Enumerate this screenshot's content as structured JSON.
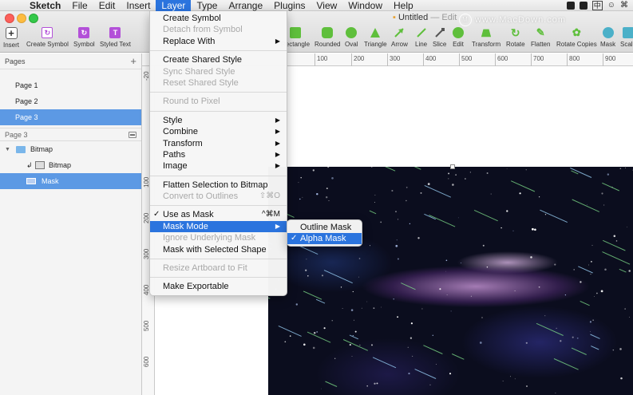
{
  "menubar": {
    "items": [
      "Sketch",
      "File",
      "Edit",
      "Insert",
      "Layer",
      "Type",
      "Arrange",
      "Plugins",
      "View",
      "Window",
      "Help"
    ],
    "active": "Layer",
    "ime_label": "中"
  },
  "window": {
    "doc_title": "Untitled",
    "doc_status": "— Edit"
  },
  "toolbar": {
    "left_items": [
      {
        "label": "Insert",
        "icon": "plus-icon"
      },
      {
        "label": "Create Symbol",
        "icon": "create-symbol-icon"
      },
      {
        "label": "Symbol",
        "icon": "symbol-icon"
      },
      {
        "label": "Styled Text",
        "icon": "styled-text-icon"
      }
    ],
    "right_items": [
      {
        "label": "Rectangle",
        "icon": "rectangle-icon"
      },
      {
        "label": "Rounded",
        "icon": "rounded-rectangle-icon"
      },
      {
        "label": "Oval",
        "icon": "oval-icon"
      },
      {
        "label": "Triangle",
        "icon": "triangle-icon"
      },
      {
        "label": "Arrow",
        "icon": "arrow-icon"
      },
      {
        "label": "Line",
        "icon": "line-icon"
      },
      {
        "label": "Slice",
        "icon": "slice-icon"
      },
      {
        "label": "Edit",
        "icon": "edit-icon"
      },
      {
        "label": "Transform",
        "icon": "transform-icon"
      },
      {
        "label": "Rotate",
        "icon": "rotate-icon"
      },
      {
        "label": "Flatten",
        "icon": "flatten-icon"
      },
      {
        "label": "Rotate Copies",
        "icon": "rotate-copies-icon"
      },
      {
        "label": "Mask",
        "icon": "mask-icon"
      },
      {
        "label": "Scale",
        "icon": "scale-icon"
      }
    ]
  },
  "sidebar": {
    "pages_header": "Pages",
    "pages": [
      "Page 1",
      "Page 2",
      "Page 3"
    ],
    "selected_page": "Page 3",
    "layers_header": "Page 3",
    "layers": [
      {
        "label": "Bitmap",
        "type": "group"
      },
      {
        "label": "Bitmap",
        "type": "image"
      },
      {
        "label": "Mask",
        "type": "mask"
      }
    ]
  },
  "rulers": {
    "top": [
      "100",
      "200",
      "300",
      "400",
      "500",
      "600",
      "700",
      "800",
      "900"
    ],
    "left": [
      "-20",
      "100",
      "200",
      "300",
      "400",
      "500",
      "600"
    ]
  },
  "layer_menu": {
    "sections": [
      [
        {
          "label": "Create Symbol",
          "enabled": true
        },
        {
          "label": "Detach from Symbol",
          "enabled": false
        },
        {
          "label": "Replace With",
          "enabled": true,
          "submenu": true
        }
      ],
      [
        {
          "label": "Create Shared Style",
          "enabled": true
        },
        {
          "label": "Sync Shared Style",
          "enabled": false
        },
        {
          "label": "Reset Shared Style",
          "enabled": false
        }
      ],
      [
        {
          "label": "Round to Pixel",
          "enabled": false
        }
      ],
      [
        {
          "label": "Style",
          "enabled": true,
          "submenu": true
        },
        {
          "label": "Combine",
          "enabled": true,
          "submenu": true
        },
        {
          "label": "Transform",
          "enabled": true,
          "submenu": true
        },
        {
          "label": "Paths",
          "enabled": true,
          "submenu": true
        },
        {
          "label": "Image",
          "enabled": true,
          "submenu": true
        }
      ],
      [
        {
          "label": "Flatten Selection to Bitmap",
          "enabled": true
        },
        {
          "label": "Convert to Outlines",
          "enabled": false,
          "shortcut": "⇧⌘O"
        }
      ],
      [
        {
          "label": "Use as Mask",
          "enabled": true,
          "checked": true,
          "shortcut": "^⌘M"
        },
        {
          "label": "Mask Mode",
          "enabled": true,
          "submenu": true,
          "highlighted": true
        },
        {
          "label": "Ignore Underlying Mask",
          "enabled": false
        },
        {
          "label": "Mask with Selected Shape",
          "enabled": true
        }
      ],
      [
        {
          "label": "Resize Artboard to Fit",
          "enabled": false
        }
      ],
      [
        {
          "label": "Make Exportable",
          "enabled": true
        }
      ]
    ]
  },
  "mask_mode_submenu": {
    "items": [
      {
        "label": "Outline Mask",
        "checked": false,
        "highlighted": false
      },
      {
        "label": "Alpha Mask",
        "checked": true,
        "highlighted": true
      }
    ]
  },
  "watermark": {
    "text": "www.MacDown.com",
    "logo_label": "M"
  },
  "colors": {
    "menu_highlight": "#2b74de",
    "sidebar_selected": "#5c99e4",
    "toolbar_green": "#5fbf3c",
    "toolbar_purple": "#b350d8"
  }
}
